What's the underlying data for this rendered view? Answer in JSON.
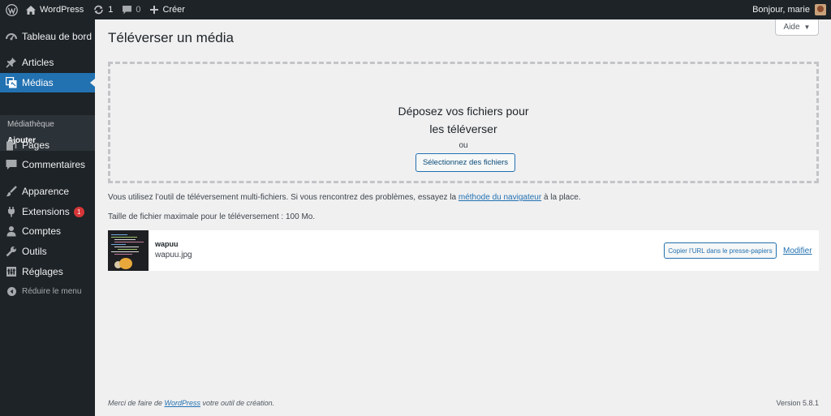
{
  "adminbar": {
    "site_name": "WordPress",
    "updates_count": "1",
    "comments_count": "0",
    "new_label": "Créer",
    "greeting": "Bonjour, marie"
  },
  "sidebar": {
    "items": [
      {
        "label": "Tableau de bord",
        "icon": "dashboard-icon"
      },
      {
        "label": "Articles",
        "icon": "pin-icon"
      },
      {
        "label": "Médias",
        "icon": "media-icon"
      },
      {
        "label": "Pages",
        "icon": "pages-icon"
      },
      {
        "label": "Commentaires",
        "icon": "comment-icon"
      },
      {
        "label": "Apparence",
        "icon": "brush-icon"
      },
      {
        "label": "Extensions",
        "icon": "plugin-icon",
        "badge": "1"
      },
      {
        "label": "Comptes",
        "icon": "users-icon"
      },
      {
        "label": "Outils",
        "icon": "wrench-icon"
      },
      {
        "label": "Réglages",
        "icon": "settings-icon"
      }
    ],
    "submenu": [
      "Médiathèque",
      "Ajouter"
    ],
    "collapse_label": "Réduire le menu"
  },
  "help_label": "Aide",
  "page_title": "Téléverser un média",
  "dropzone": {
    "info_line1": "Déposez vos fichiers pour",
    "info_line2": "les téléverser",
    "or_label": "ou",
    "select_button": "Sélectionnez des fichiers"
  },
  "notes": {
    "multi_before": "Vous utilisez l’outil de téléversement multi-fichiers. Si vous rencontrez des problèmes, essayez la ",
    "multi_link": "méthode du navigateur",
    "multi_after": " à la place.",
    "max_size": "Taille de fichier maximale pour le téléversement : 100 Mo."
  },
  "media_item": {
    "title": "wapuu",
    "filename": "wapuu.jpg",
    "copy_button": "Copier l’URL dans le presse-papiers",
    "edit_link": "Modifier"
  },
  "footer": {
    "thanks_before": "Merci de faire de ",
    "thanks_link": "WordPress",
    "thanks_after": " votre outil de création.",
    "version": "Version 5.8.1"
  },
  "colors": {
    "admin_dark": "#1d2327",
    "accent": "#2271b1",
    "badge": "#d63638",
    "background": "#f0f0f1"
  }
}
